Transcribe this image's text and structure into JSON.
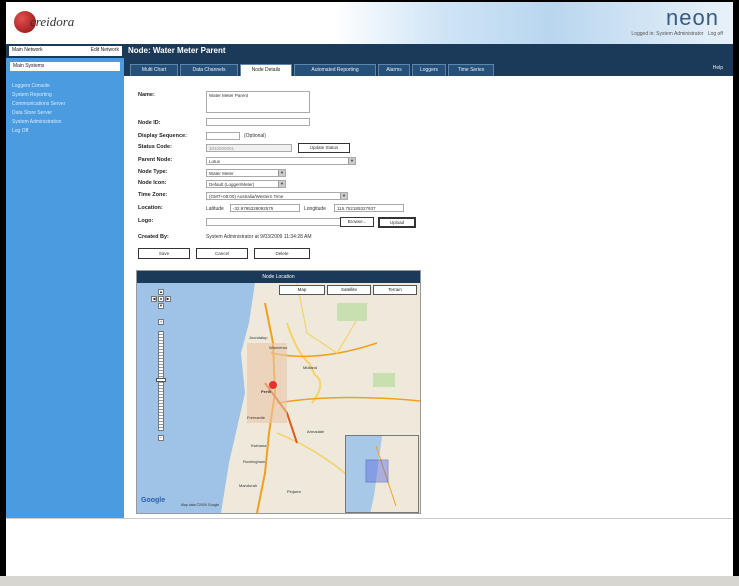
{
  "header": {
    "brand_word": "creidora",
    "app_name": "neon",
    "login_text": "Logged in: System Administrator",
    "logout_label": "Log off"
  },
  "topbar": {
    "network_label": "Main Network",
    "network_action": "Edit Network",
    "node_title": "Node: Water Meter Parent"
  },
  "sidebar": {
    "system_select": "Main Systems",
    "items": [
      {
        "label": "Loggers Console"
      },
      {
        "label": "System Reporting"
      },
      {
        "label": "Communications Server"
      },
      {
        "label": "Data Store Server"
      },
      {
        "label": "System Administration"
      },
      {
        "label": "Log Off"
      }
    ]
  },
  "tabs": [
    {
      "label": "Multi Chart"
    },
    {
      "label": "Data Channels"
    },
    {
      "label": "Node Details"
    },
    {
      "label": "Automated Reporting"
    },
    {
      "label": "Alarms"
    },
    {
      "label": "Loggers"
    },
    {
      "label": "Time Series"
    }
  ],
  "help_label": "Help",
  "form": {
    "name_label": "Name:",
    "name_value": "Water Meter Parent",
    "node_id_label": "Node ID:",
    "node_id_value": "",
    "display_seq_label": "Display Sequence:",
    "display_seq_value": "",
    "optional_note": "(Optional)",
    "status_code_label": "Status Code:",
    "status_code_value": "3032000001",
    "status_code_button": "Update Status",
    "parent_node_label": "Parent Node:",
    "parent_node_value": "Lotus",
    "node_type_label": "Node Type:",
    "node_type_value": "Water Meter",
    "node_icon_label": "Node Icon:",
    "node_icon_value": "Default (Logger/Meter)",
    "time_zone_label": "Time Zone:",
    "time_zone_value": "(GMT+08:00) Australia/Western Time",
    "location_label": "Location:",
    "latitude_label": "Latitude",
    "latitude_value": "-32.9795328092575",
    "longitude_label": "Longitude",
    "longitude_value": "115.752185327937",
    "logo_label": "Logo:",
    "browse_label": "Browse...",
    "upload_label": "Upload",
    "created_by_label": "Created By:",
    "created_by_value": "System Administrator at 9/03/2009 11:34:28 AM",
    "save_label": "Save",
    "cancel_label": "Cancel",
    "delete_label": "Delete"
  },
  "map": {
    "panel_title": "Node Location",
    "map_button": "Map",
    "satellite_button": "Satellite",
    "terrain_button": "Terrain",
    "google_logo": "Google",
    "map_data_note": "Map data ©2009 Google",
    "place_labels": [
      {
        "text": "Joondalup"
      },
      {
        "text": "Wanneroo"
      },
      {
        "text": "Midland"
      },
      {
        "text": "Perth"
      },
      {
        "text": "Fremantle"
      },
      {
        "text": "Armadale"
      },
      {
        "text": "Kwinana"
      },
      {
        "text": "Rockingham"
      },
      {
        "text": "Mandurah"
      },
      {
        "text": "Pinjarra"
      }
    ]
  },
  "colors": {
    "nav_dark": "#1b3a5a",
    "sidebar_blue": "#4b9be0",
    "brand_red": "#b22020"
  }
}
